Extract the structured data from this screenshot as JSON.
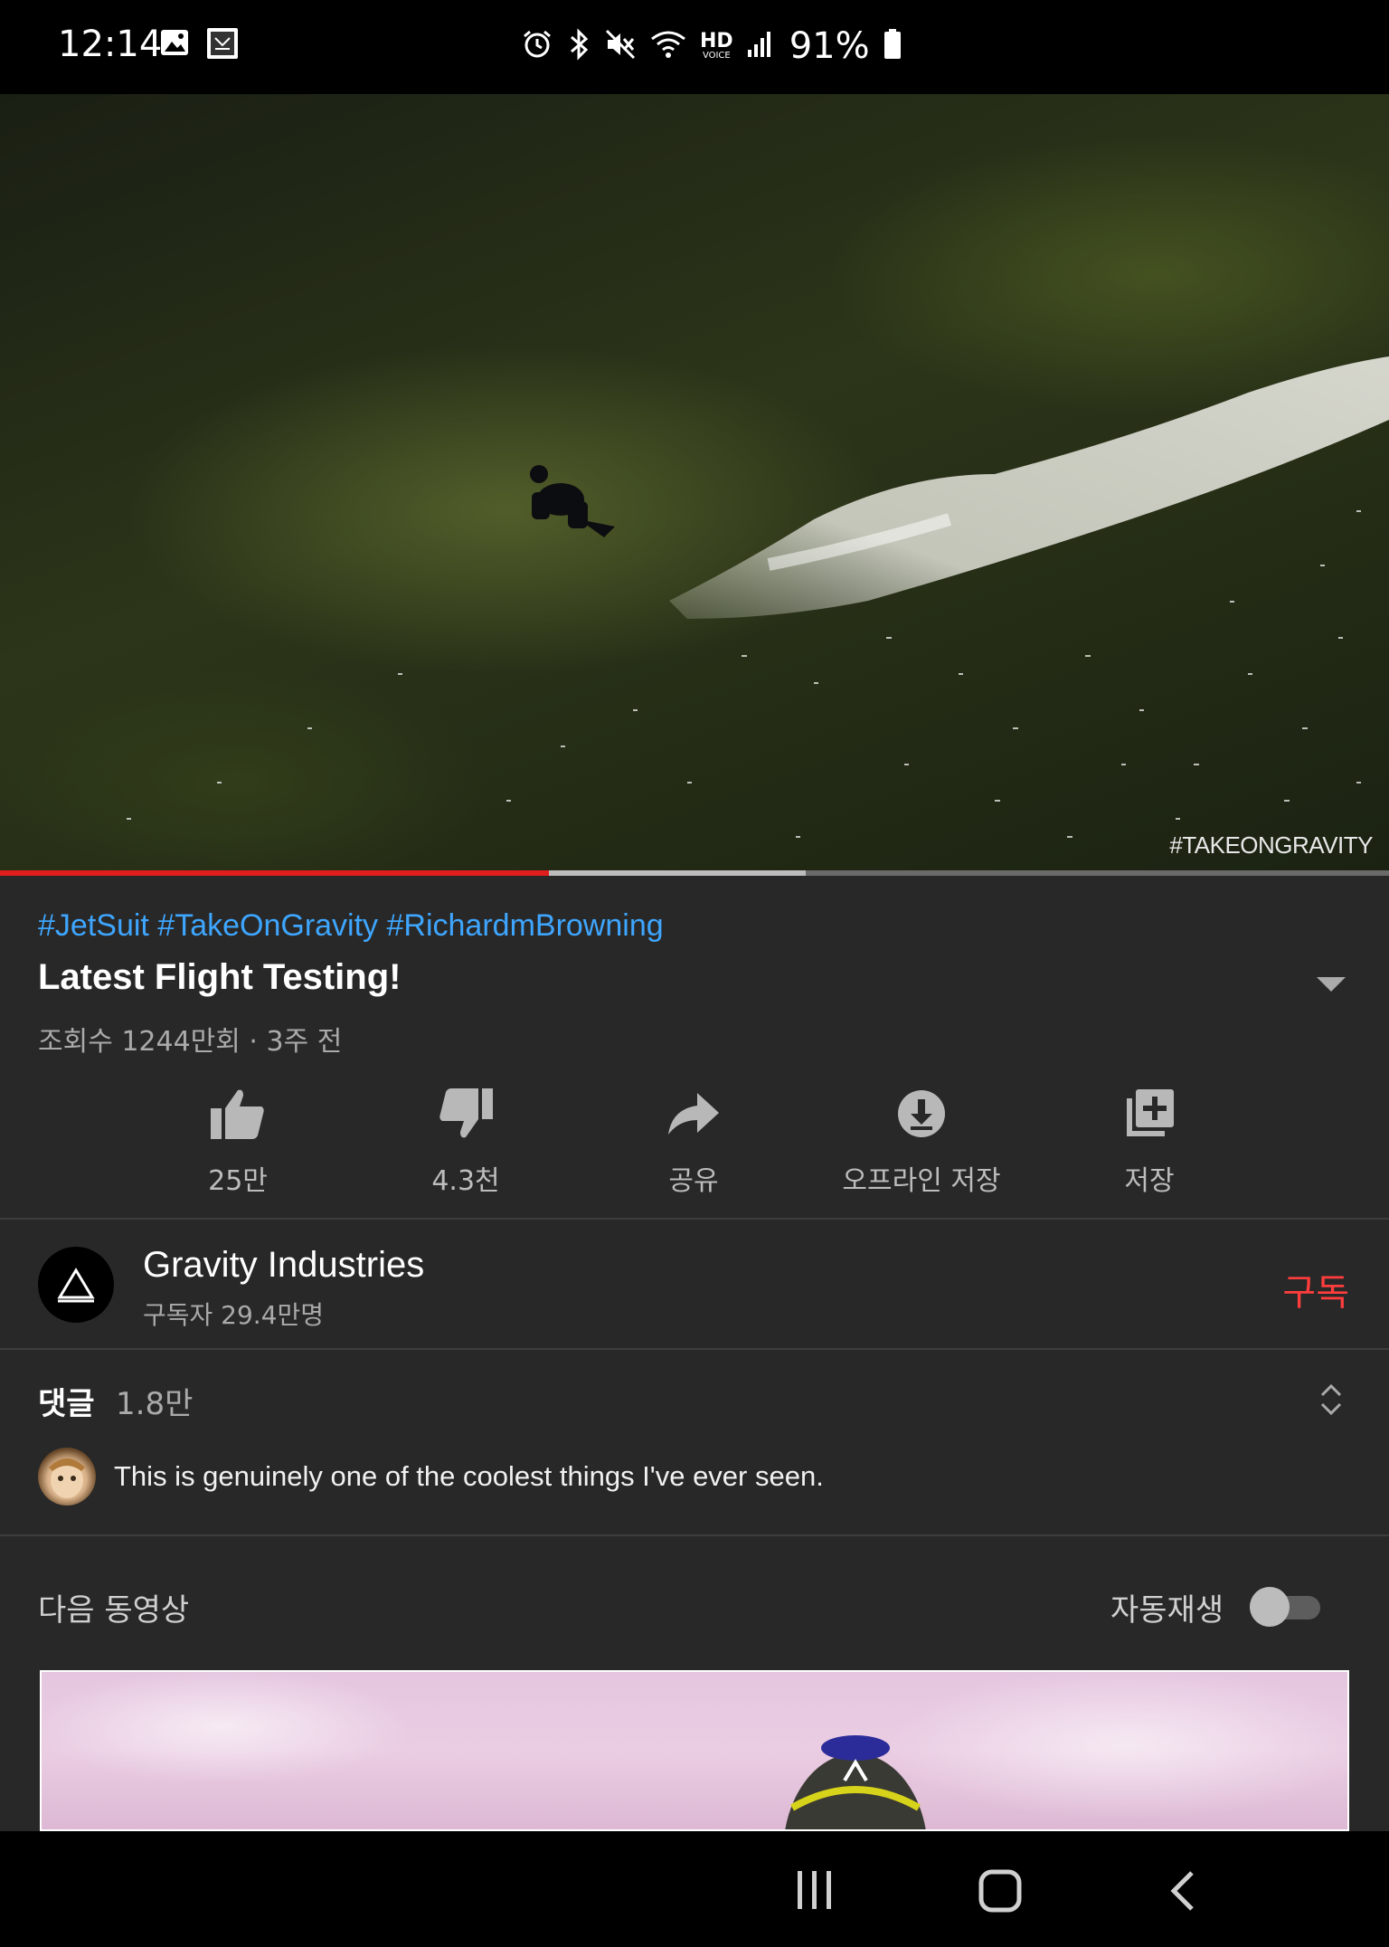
{
  "status_bar": {
    "time": "12:14",
    "battery": "91%",
    "icons": [
      "image-icon",
      "app-icon",
      "alarm-icon",
      "bluetooth-icon",
      "mute-icon",
      "wifi-icon",
      "hd-voice-icon",
      "signal-icon",
      "battery-icon"
    ],
    "hd_label": "HD",
    "voice_label": "VOICE"
  },
  "video": {
    "watermark": "#TAKEONGRAVITY",
    "progress_played_pct": 39.5,
    "progress_buffered_pct": 58
  },
  "info": {
    "hashtags": "#JetSuit #TakeOnGravity #RichardmBrowning",
    "title": "Latest Flight Testing!",
    "meta": "조회수 1244만회 · 3주 전"
  },
  "actions": [
    {
      "label": "25만",
      "icon": "thumbs-up-icon"
    },
    {
      "label": "4.3천",
      "icon": "thumbs-down-icon"
    },
    {
      "label": "공유",
      "icon": "share-icon"
    },
    {
      "label": "오프라인 저장",
      "icon": "download-icon"
    },
    {
      "label": "저장",
      "icon": "add-to-playlist-icon"
    }
  ],
  "channel": {
    "name": "Gravity Industries",
    "subscribers": "구독자 29.4만명",
    "subscribe_label": "구독"
  },
  "comments": {
    "heading": "댓글",
    "count": "1.8만",
    "top_comment": "This is genuinely one of the coolest things I've ever seen."
  },
  "up_next": {
    "label": "다음 동영상",
    "autoplay_label": "자동재생",
    "autoplay_on": false
  },
  "colors": {
    "background": "#282828",
    "accent_red": "#e01e1e",
    "subscribe_red": "#ff3d3d",
    "link_blue": "#3ea6ff"
  }
}
